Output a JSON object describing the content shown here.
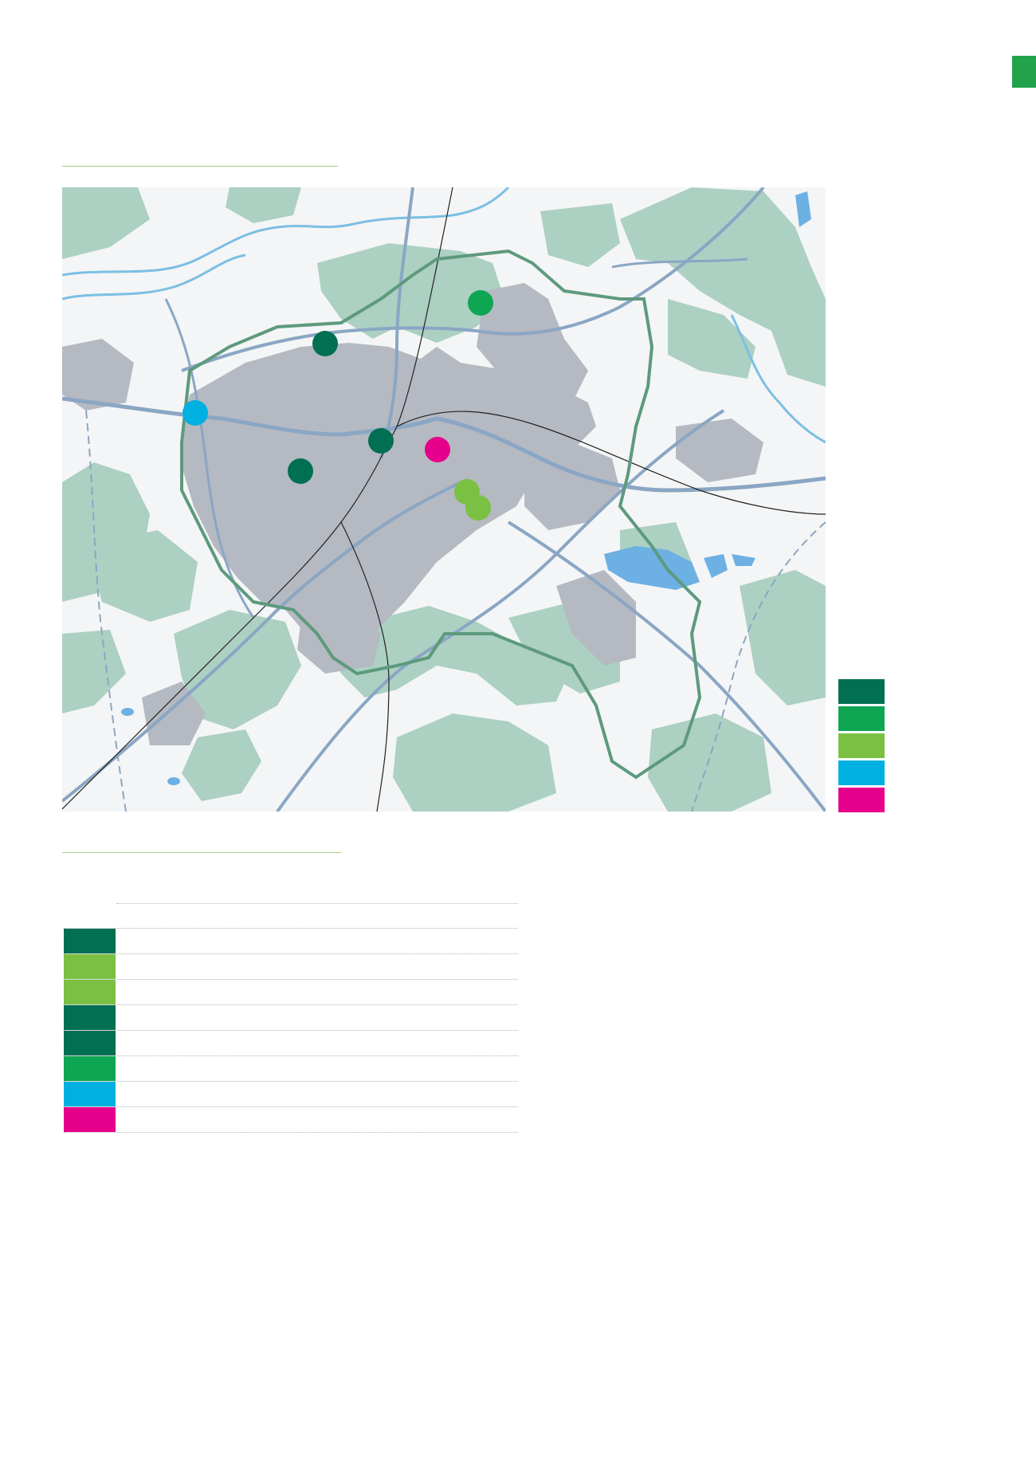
{
  "page": {
    "tab_color": "#21a24b",
    "rule_color": "#a3cf86"
  },
  "map": {
    "colors": {
      "background": "#f4f5f6",
      "forest": "#acd0c2",
      "urban": "#b5b9c1",
      "water": "#6db0e3",
      "river": "#7bbfe4",
      "road": "#8aa6c4",
      "boundary": "#5d9a7d"
    },
    "markers": [
      {
        "name": "marker-dark-green-1",
        "color": "#006f52"
      },
      {
        "name": "marker-dark-green-2",
        "color": "#006f52"
      },
      {
        "name": "marker-dark-green-3",
        "color": "#006f52"
      },
      {
        "name": "marker-medium-green",
        "color": "#0fa653"
      },
      {
        "name": "marker-light-green-1",
        "color": "#7ac143"
      },
      {
        "name": "marker-light-green-2",
        "color": "#7ac143"
      },
      {
        "name": "marker-cyan",
        "color": "#00b0e0"
      },
      {
        "name": "marker-magenta",
        "color": "#e6008c"
      }
    ]
  },
  "legend": [
    {
      "color": "#006f52"
    },
    {
      "color": "#0fa653"
    },
    {
      "color": "#7ac143"
    },
    {
      "color": "#00b0e0"
    },
    {
      "color": "#e6008c"
    }
  ],
  "table": {
    "rows": [
      {
        "color": "",
        "text": ""
      },
      {
        "color": "#006f52",
        "text": ""
      },
      {
        "color": "#7ac143",
        "text": ""
      },
      {
        "color": "#7ac143",
        "text": ""
      },
      {
        "color": "#006f52",
        "text": ""
      },
      {
        "color": "#006f52",
        "text": ""
      },
      {
        "color": "#0fa653",
        "text": ""
      },
      {
        "color": "#00b0e0",
        "text": ""
      },
      {
        "color": "#e6008c",
        "text": ""
      }
    ]
  }
}
